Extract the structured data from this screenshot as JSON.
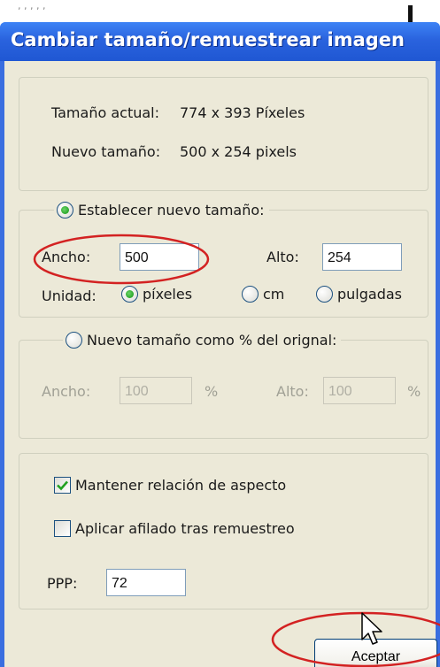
{
  "window": {
    "title": "Cambiar tamaño/remuestrear imagen"
  },
  "info": {
    "current_label": "Tamaño actual:",
    "current_value": "774  x  393  Píxeles",
    "new_label": "Nuevo tamaño:",
    "new_value": "500  x  254  pixels"
  },
  "absolute": {
    "radio_label": "Establecer nuevo tamaño:",
    "width_label": "Ancho:",
    "width_value": "500",
    "height_label": "Alto:",
    "height_value": "254",
    "unit_label": "Unidad:",
    "units": [
      "píxeles",
      "cm",
      "pulgadas"
    ],
    "selected_unit": "píxeles"
  },
  "percent": {
    "radio_label": "Nuevo tamaño como % del orignal:",
    "width_label": "Ancho:",
    "width_value": "100",
    "width_unit": "%",
    "height_label": "Alto:",
    "height_value": "100",
    "height_unit": "%"
  },
  "options": {
    "keep_aspect_label": "Mantener relación de aspecto",
    "keep_aspect_checked": true,
    "sharpen_label": "Aplicar afilado tras remuestreo",
    "sharpen_checked": false,
    "dpi_label": "PPP:",
    "dpi_value": "72"
  },
  "buttons": {
    "accept_label": "Aceptar"
  },
  "colors": {
    "titlebar": "#2a63de",
    "dialog_bg": "#ece9d8",
    "annotation": "#d32222",
    "radio_dot": "#21a121"
  }
}
